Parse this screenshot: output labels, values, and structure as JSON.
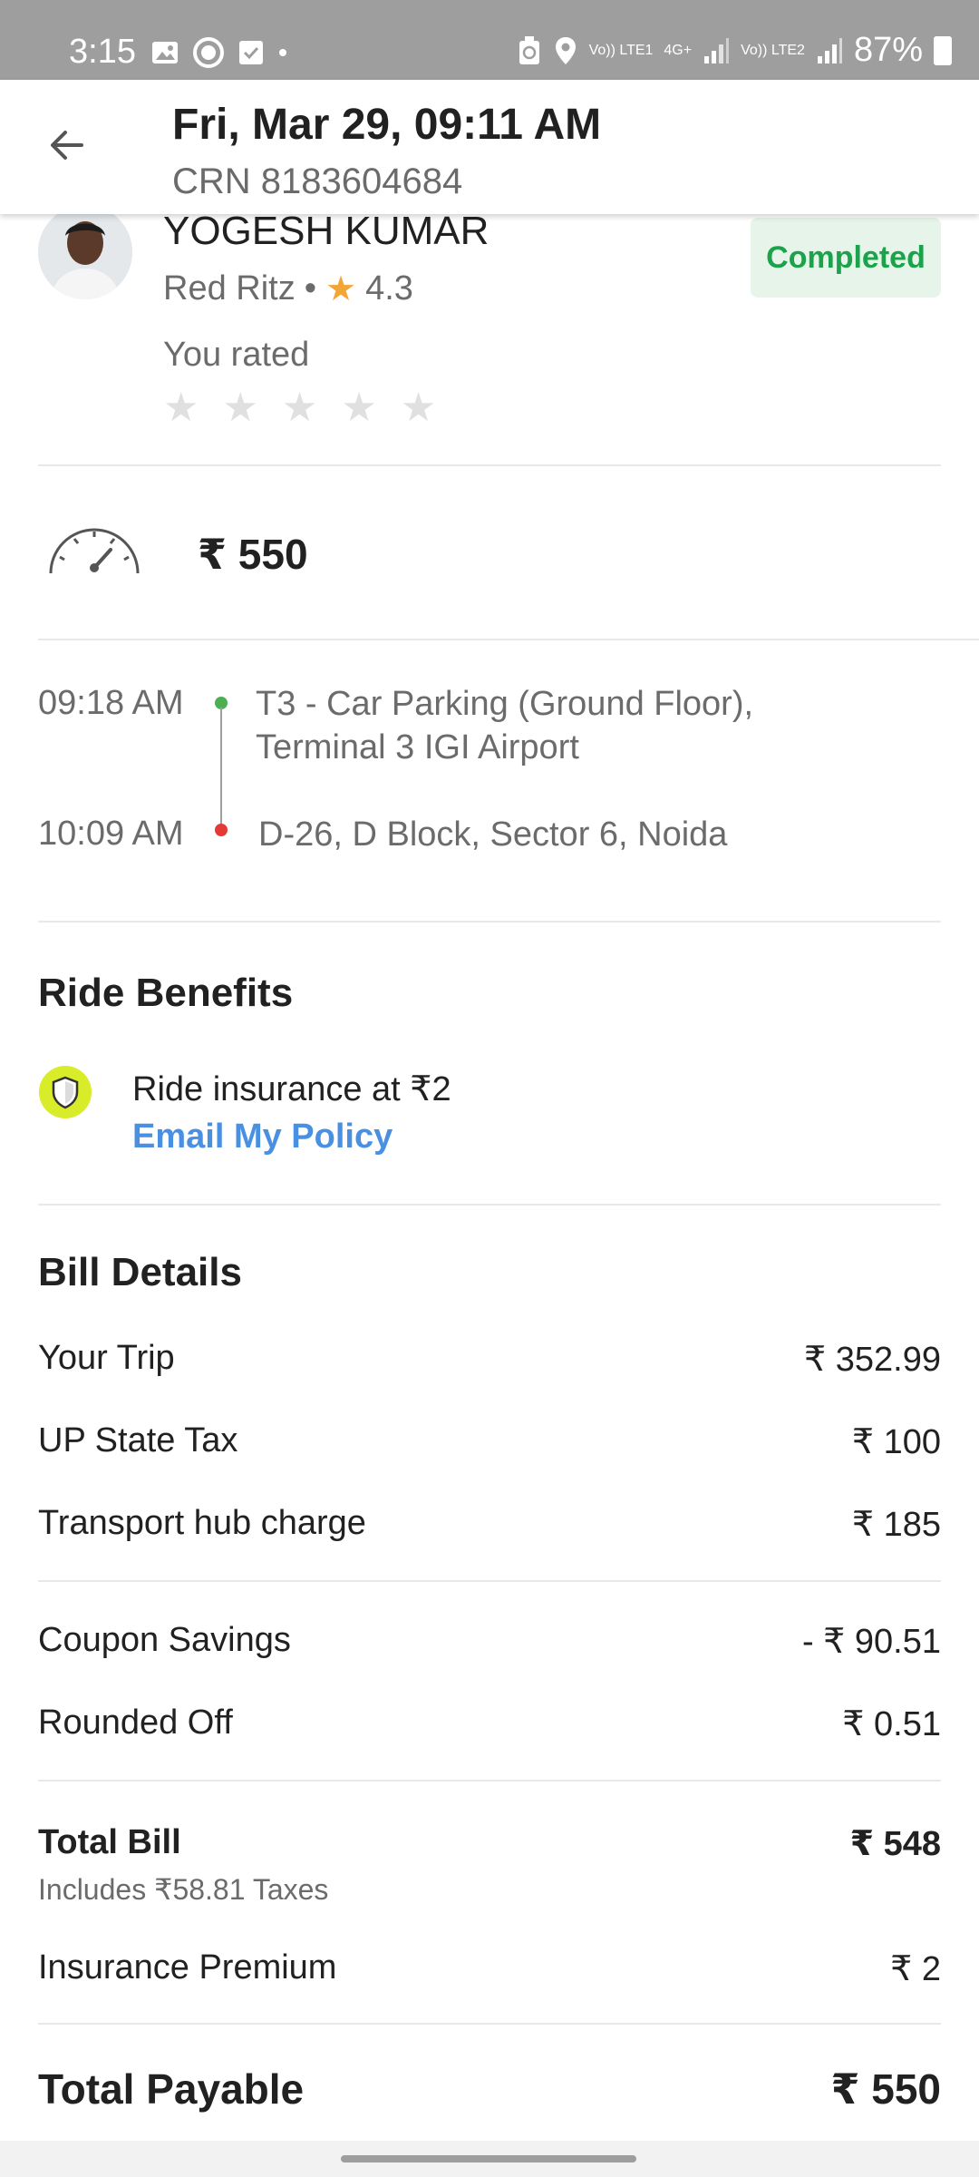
{
  "status_bar": {
    "time": "3:15",
    "network_1": "Vo)) LTE1",
    "network_2": "4G+",
    "network_3": "Vo)) LTE2",
    "battery": "87%"
  },
  "header": {
    "title": "Fri, Mar 29, 09:11 AM",
    "crn": "CRN 8183604684",
    "back_icon": "arrow-back-icon"
  },
  "driver": {
    "name": "YOGESH KUMAR",
    "car": "Red Ritz",
    "separator": "•",
    "rating": "4.3",
    "status": "Completed",
    "you_rated_label": "You rated",
    "stars_filled": 0,
    "stars_total": 5
  },
  "fare": {
    "amount": "₹ 550",
    "icon": "speedometer-icon"
  },
  "route": {
    "pickup_time": "09:18 AM",
    "pickup_line1": "T3 - Car Parking (Ground Floor),",
    "pickup_line2": "Terminal 3 IGI Airport",
    "drop_time": "10:09 AM",
    "drop_address": "D-26, D Block, Sector 6, Noida",
    "pickup_color": "#4caf50",
    "drop_color": "#e53935"
  },
  "benefits": {
    "title": "Ride Benefits",
    "insurance_text": "Ride insurance at ₹2",
    "email_link": "Email My Policy"
  },
  "bill": {
    "title": "Bill Details",
    "rows": [
      {
        "label": "Your Trip",
        "value": "₹ 352.99"
      },
      {
        "label": "UP State Tax",
        "value": "₹ 100"
      },
      {
        "label": "Transport hub charge",
        "value": "₹ 185"
      },
      {
        "label": "Coupon Savings",
        "value": "- ₹ 90.51"
      },
      {
        "label": "Rounded Off",
        "value": "₹ 0.51"
      }
    ],
    "total_bill_label": "Total Bill",
    "total_bill_value": "₹ 548",
    "taxes_note": "Includes ₹58.81 Taxes",
    "insurance_label": "Insurance Premium",
    "insurance_value": "₹ 2",
    "payable_label": "Total Payable",
    "payable_value": "₹ 550"
  },
  "colors": {
    "completed_green": "#1aa34a",
    "link_blue": "#4a90e2",
    "star_gold": "#f3a536"
  }
}
